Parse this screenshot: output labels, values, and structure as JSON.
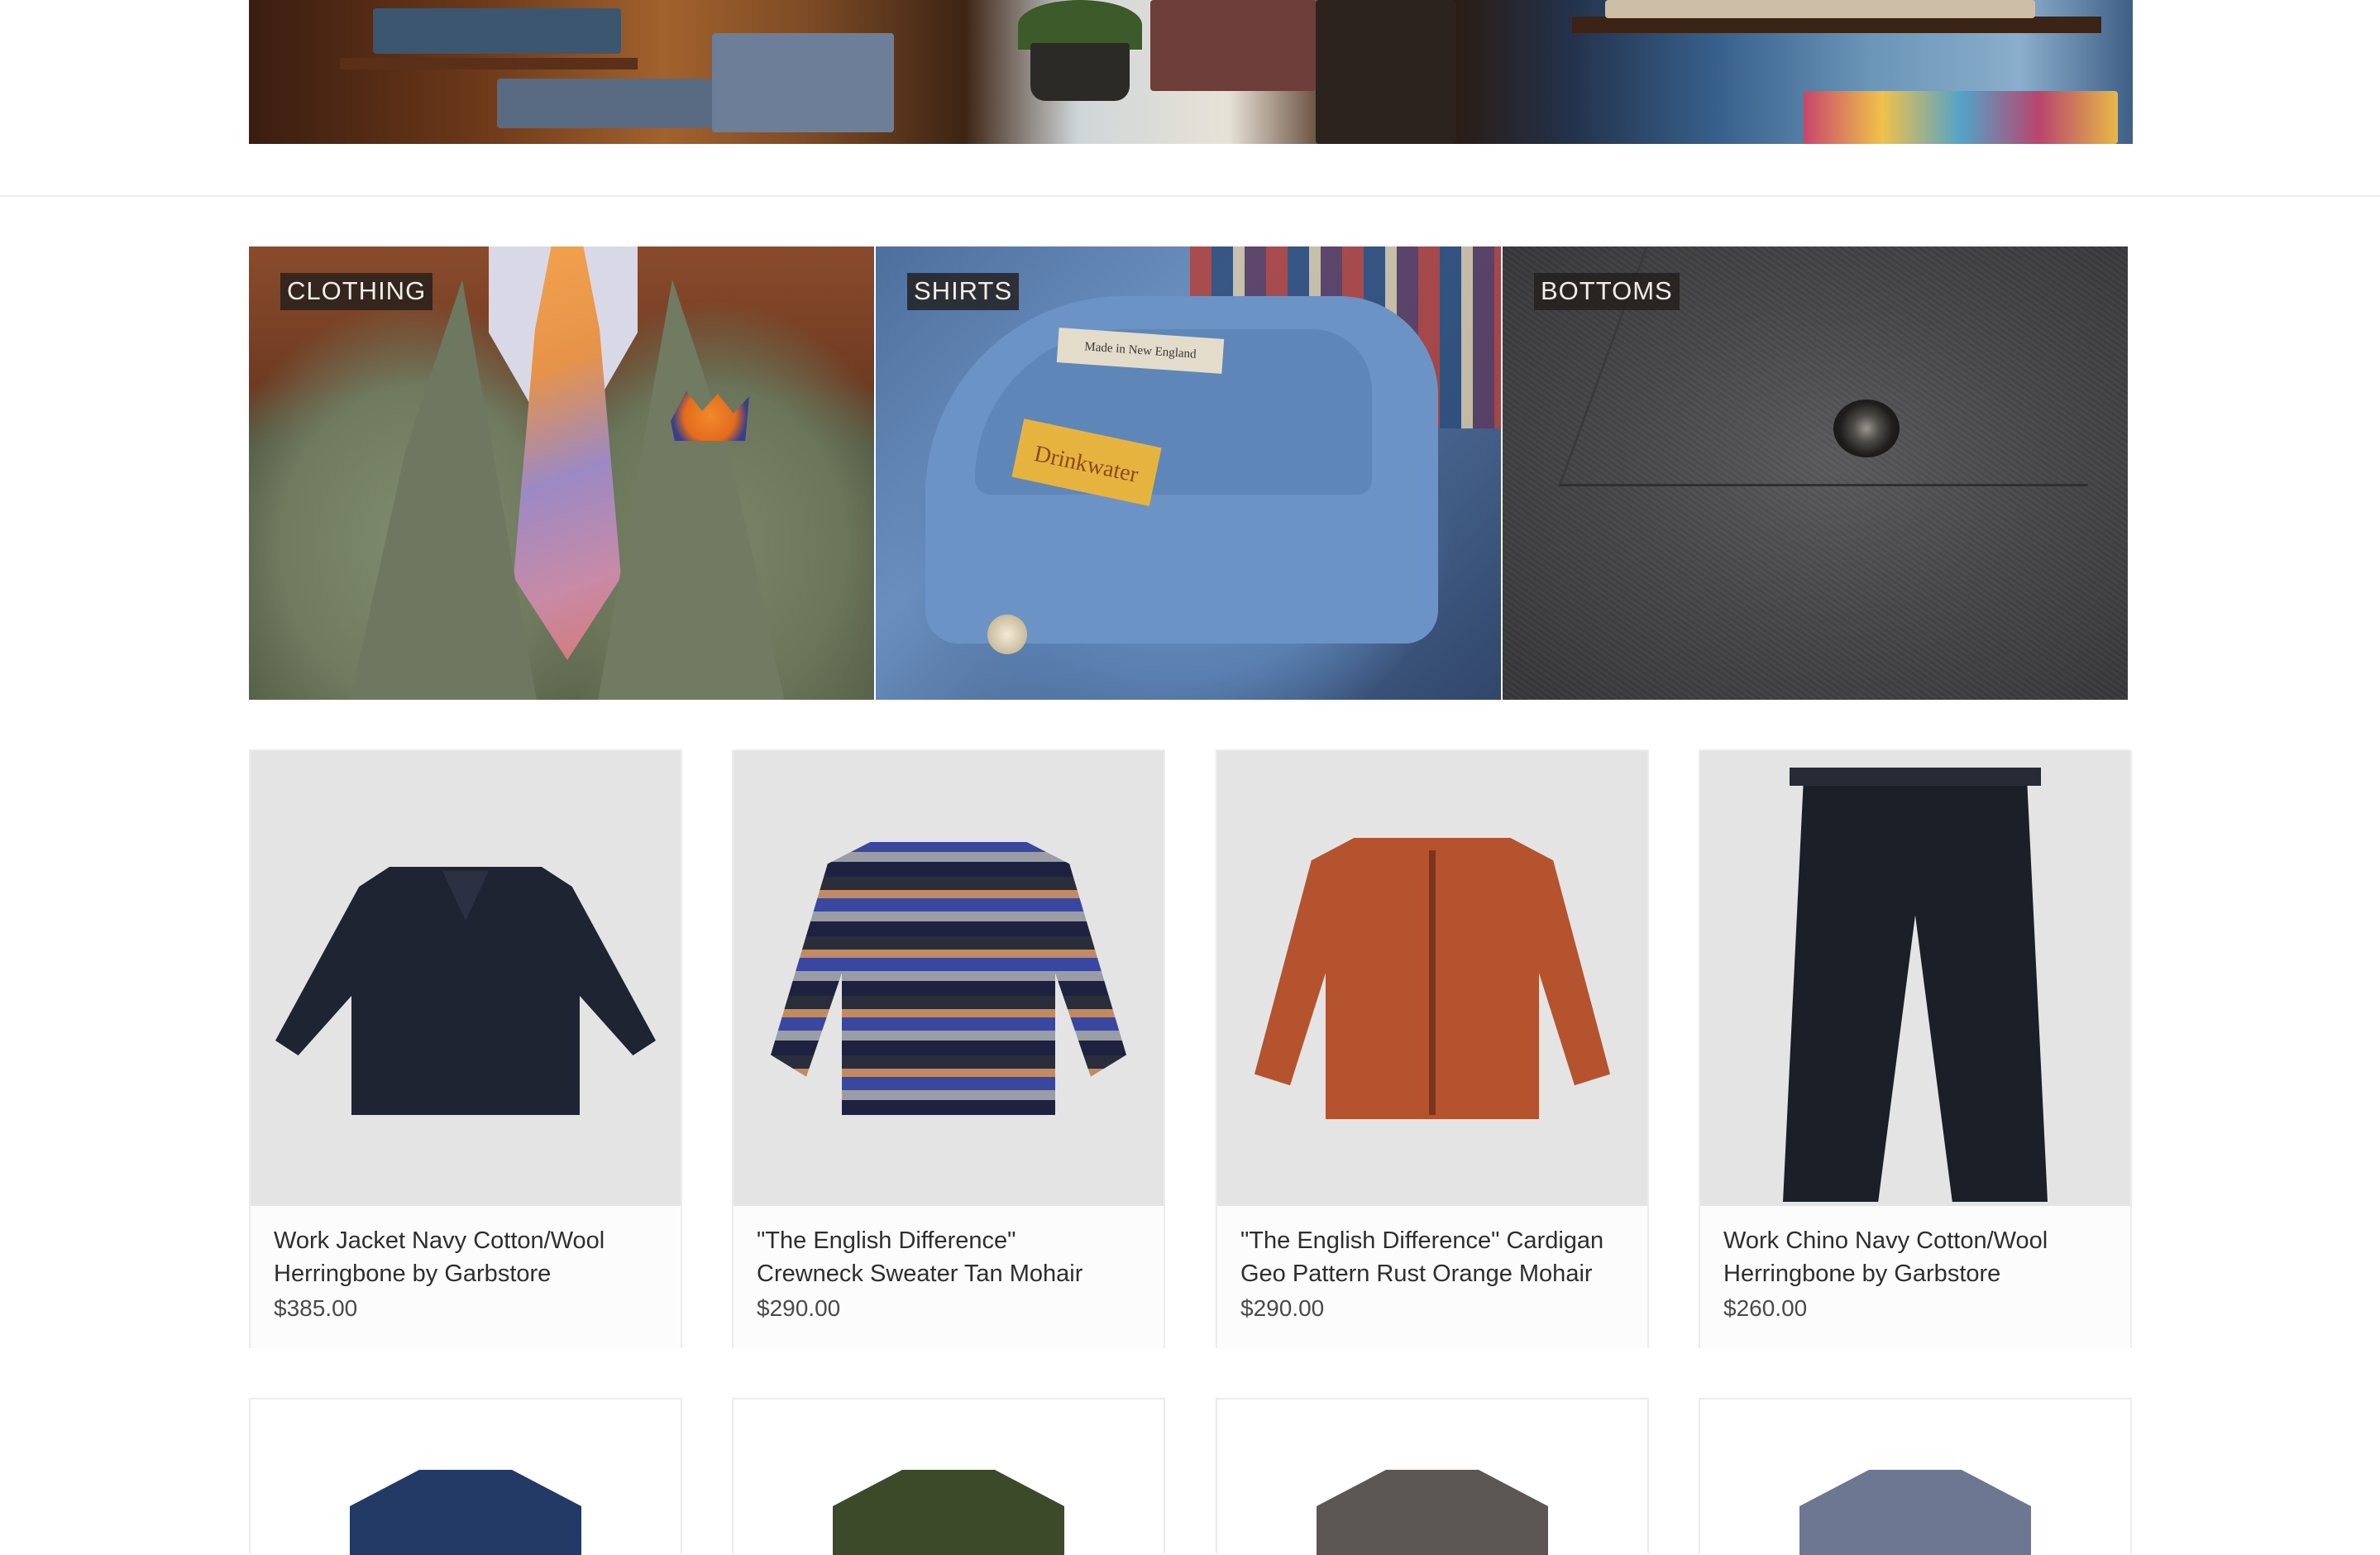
{
  "categories": [
    {
      "label": "CLOTHING"
    },
    {
      "label": "SHIRTS"
    },
    {
      "label": "BOTTOMS"
    }
  ],
  "shirt_tag": {
    "brand": "Drinkwater",
    "made_in": "Made in New England"
  },
  "products": [
    {
      "name_line1": "Work Jacket Navy Cotton/Wool",
      "name_line2": "Herringbone by Garbstore",
      "price": "$385.00"
    },
    {
      "name_line1": "\"The English Difference\"",
      "name_line2": "Crewneck Sweater Tan Mohair",
      "price": "$290.00"
    },
    {
      "name_line1": "\"The English Difference\" Cardigan",
      "name_line2": "Geo Pattern Rust Orange Mohair",
      "price": "$290.00"
    },
    {
      "name_line1": "Work Chino Navy Cotton/Wool",
      "name_line2": "Herringbone by Garbstore",
      "price": "$260.00"
    }
  ],
  "colors": {
    "label_bg": "#231e1c",
    "card_image_bg": "#e4e4e4",
    "divider": "#ececec",
    "navy": "#1e2333",
    "rust": "#b5532f"
  }
}
